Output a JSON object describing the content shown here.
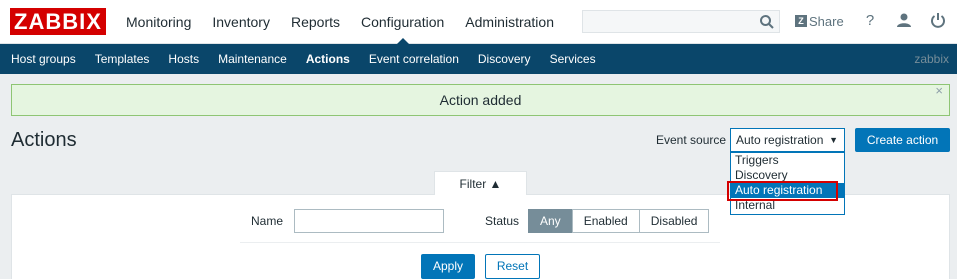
{
  "brand": {
    "logo_text": "ZABBIX",
    "logo_color": "#d40000"
  },
  "main_menu": [
    {
      "label": "Monitoring"
    },
    {
      "label": "Inventory"
    },
    {
      "label": "Reports"
    },
    {
      "label": "Configuration",
      "active": true
    },
    {
      "label": "Administration"
    }
  ],
  "search": {
    "placeholder": "",
    "icon": "search-icon"
  },
  "top_actions": {
    "share_label": "Share",
    "help_icon": "?",
    "user_icon": "user-icon",
    "logout_icon": "power-icon"
  },
  "sub_menu": [
    {
      "label": "Host groups"
    },
    {
      "label": "Templates"
    },
    {
      "label": "Hosts"
    },
    {
      "label": "Maintenance"
    },
    {
      "label": "Actions",
      "active": true
    },
    {
      "label": "Event correlation"
    },
    {
      "label": "Discovery"
    },
    {
      "label": "Services"
    }
  ],
  "user_name": "zabbix",
  "message": {
    "text": "Action added",
    "close": "×"
  },
  "page": {
    "title": "Actions"
  },
  "event_source": {
    "label": "Event source",
    "selected": "Auto registration",
    "arrow": "▼",
    "options": [
      "Triggers",
      "Discovery",
      "Auto registration",
      "Internal"
    ],
    "highlighted_option": "Auto registration"
  },
  "create_button": "Create action",
  "filter": {
    "tab_label": "Filter ▲",
    "name_label": "Name",
    "name_value": "",
    "status_label": "Status",
    "status_options": [
      "Any",
      "Enabled",
      "Disabled"
    ],
    "status_selected": "Any",
    "apply_label": "Apply",
    "reset_label": "Reset"
  },
  "colors": {
    "nav_bg": "#0a466a",
    "accent": "#0275b8",
    "success_bg": "#e5f5e0",
    "success_border": "#8ec574"
  }
}
